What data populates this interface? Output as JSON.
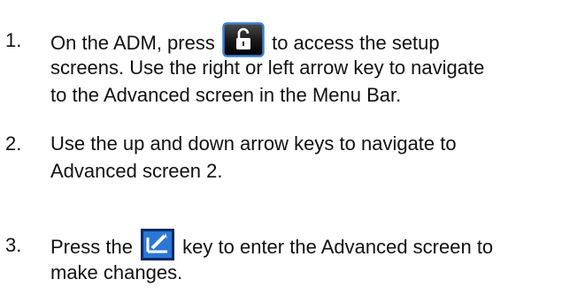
{
  "steps": [
    {
      "number": "1.",
      "line1_before": "On the ADM, press ",
      "line1_after": " to access the setup",
      "line2": "screens. Use the right or left arrow key to navigate",
      "line3": "to the Advanced screen in the Menu Bar.",
      "icon": "unlock-key-icon"
    },
    {
      "number": "2.",
      "line1": "Use the up and down arrow keys to navigate to",
      "line2": "Advanced screen 2."
    },
    {
      "number": "3.",
      "line1_before": "Press the ",
      "line1_after": " key to enter the Advanced screen to",
      "line2": "make changes.",
      "icon": "edit-key-icon"
    }
  ],
  "colors": {
    "text": "#111111",
    "unlock_key_body": "#1a1a1a",
    "unlock_key_border": "#3d7fd0",
    "edit_key_body": "#2a77d6",
    "edit_key_frame": "#0b2a66"
  }
}
